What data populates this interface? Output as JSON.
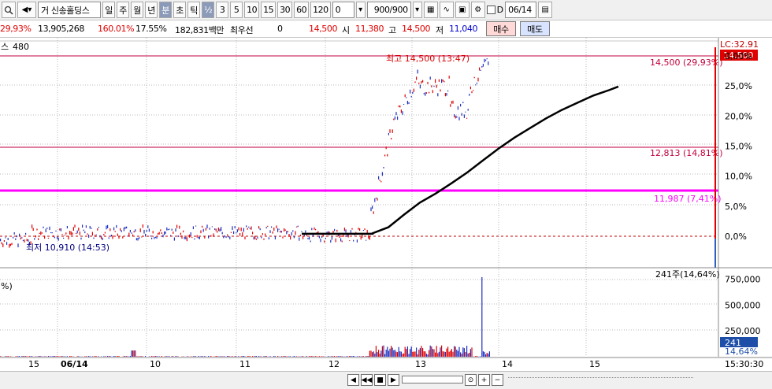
{
  "toolbar": {
    "stock_name": "신송홀딩스",
    "prefix": "거",
    "periods": [
      "일",
      "주",
      "월",
      "년",
      "분",
      "초",
      "틱"
    ],
    "active_period": "분",
    "fraction": "½",
    "intervals": [
      "3",
      "5",
      "10",
      "15",
      "30",
      "60",
      "120"
    ],
    "count_value": "0",
    "range_value": "900/900",
    "date_value": "06/14",
    "checkbox_label": "D"
  },
  "quote": {
    "change_pct": "29,93%",
    "volume": "13,905,268",
    "volume_ratio": "160.01%",
    "turnover": "17.55%",
    "amount": "182,831백만",
    "best_ask_label": "최우선",
    "best_ask_value": "0",
    "price": "14,500",
    "open_label": "시",
    "open_value": "11,380",
    "high_label": "고",
    "high_value": "14,500",
    "low_label": "저",
    "low_value": "11,040",
    "buy_label": "매수",
    "sell_label": "매도"
  },
  "chart_data": {
    "type": "line",
    "header_left": "스",
    "header_value": "480",
    "lc_label": "LC:32.91",
    "price_tag": "14,500",
    "high_annotation": "최고 14,500 (13:47)",
    "low_annotation": "최저 10,910 (14:53)",
    "levels": [
      {
        "label": "14,500 (29,93%)",
        "color": "#c0003c"
      },
      {
        "label": "12,813 (14,81%)",
        "color": "#c0003c"
      },
      {
        "label": "11,987 (7,41%)",
        "color": "#ff00ff"
      }
    ],
    "y_ticks": [
      "0,00%",
      "25,0%",
      "20,0%",
      "15,0%",
      "10,0%",
      "5,0%",
      "0,0%"
    ],
    "y_tick_values": [
      30,
      25,
      20,
      15,
      10,
      5,
      0
    ],
    "ylim": [
      -6,
      31
    ],
    "x_ticks": [
      "15",
      "06/14",
      "10",
      "11",
      "12",
      "13",
      "14",
      "15"
    ],
    "moving_average": [
      [
        0,
        0.4
      ],
      [
        4,
        0.4
      ],
      [
        4.5,
        0.5
      ],
      [
        4.75,
        1.5
      ],
      [
        5.0,
        3.6
      ],
      [
        5.25,
        5.6
      ],
      [
        5.5,
        7.1
      ],
      [
        5.75,
        8.8
      ],
      [
        6.0,
        10.6
      ],
      [
        6.25,
        12.6
      ],
      [
        6.5,
        14.6
      ],
      [
        6.75,
        16.4
      ],
      [
        7.0,
        18.0
      ],
      [
        7.25,
        19.6
      ],
      [
        7.5,
        21.0
      ],
      [
        7.75,
        22.2
      ],
      [
        8.0,
        23.4
      ],
      [
        8.25,
        24.3
      ],
      [
        8.4,
        24.9
      ]
    ],
    "volume_panel": {
      "left_label": "%)",
      "annotation": "241주(14,64%)",
      "y_ticks": [
        "750,000",
        "500,000",
        "250,000"
      ],
      "y_tick_values": [
        750000,
        500000,
        250000
      ],
      "current_value": "241",
      "current_pct": "14,64%",
      "spike_value": 770000
    },
    "time_label": "15:30:30"
  }
}
